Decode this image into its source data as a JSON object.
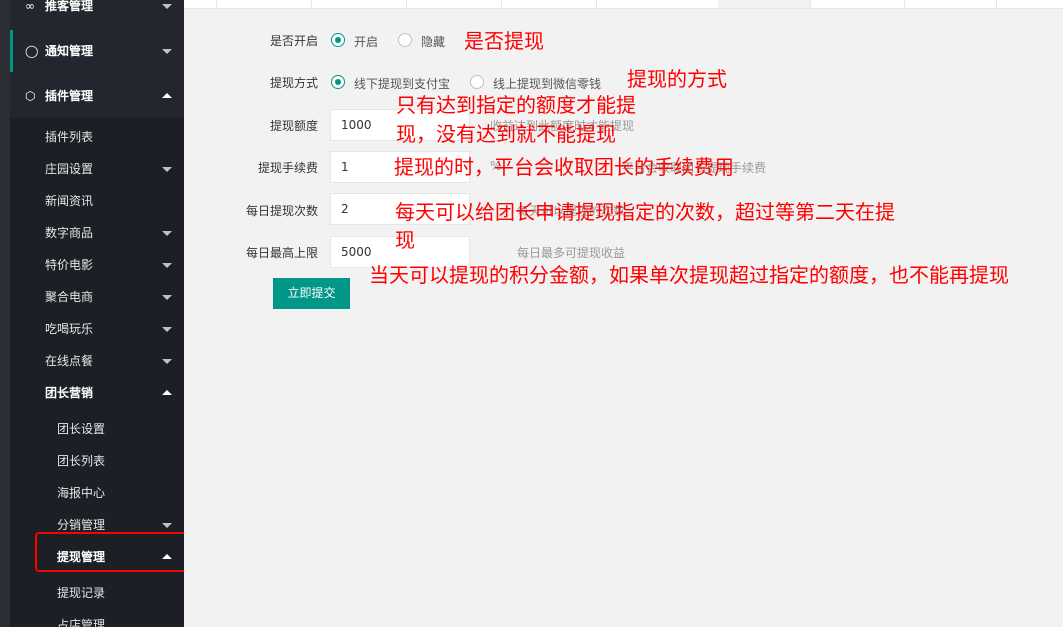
{
  "sidebar": {
    "top_items": [
      {
        "label": "推客管理",
        "icon": "share-icon"
      },
      {
        "label": "通知管理",
        "icon": "bell-icon"
      },
      {
        "label": "插件管理",
        "icon": "plugin-icon"
      }
    ],
    "plugin_items": [
      {
        "label": "插件列表"
      },
      {
        "label": "庄园设置"
      },
      {
        "label": "新闻资讯"
      },
      {
        "label": "数字商品"
      },
      {
        "label": "特价电影"
      },
      {
        "label": "聚合电商"
      },
      {
        "label": "吃喝玩乐"
      },
      {
        "label": "在线点餐"
      },
      {
        "label": "团长营销"
      }
    ],
    "leader_items": [
      {
        "label": "团长设置"
      },
      {
        "label": "团长列表"
      },
      {
        "label": "海报中心"
      },
      {
        "label": "分销管理"
      },
      {
        "label": "提现管理"
      },
      {
        "label": "提现记录"
      },
      {
        "label": "占店管理"
      }
    ],
    "colors": {
      "bg": "#23262e",
      "accent": "#009688",
      "highlight_border": "#ff0000"
    }
  },
  "form": {
    "enabled": {
      "label": "是否开启",
      "options": [
        "开启",
        "隐藏"
      ],
      "selected": "开启"
    },
    "method": {
      "label": "提现方式",
      "options": [
        "线下提现到支付宝",
        "线上提现到微信零钱"
      ],
      "selected": "线下提现到支付宝"
    },
    "amount": {
      "label": "提现额度",
      "value": "1000",
      "hint": "收益达到此额度时才能提现"
    },
    "fee": {
      "label": "提现手续费",
      "value": "1",
      "unit": "%",
      "hint": "平台会收取团长提现手续费"
    },
    "daily_count": {
      "label": "每日提现次数",
      "value": "2",
      "hint": "每天可以提现的次数"
    },
    "daily_max": {
      "label": "每日最高上限",
      "value": "5000",
      "hint": "每日最多可提现收益"
    },
    "submit_label": "立即提交",
    "colors": {
      "primary": "#009688"
    }
  },
  "annotations": {
    "enabled_note": "是否提现",
    "method_note": "提现的方式",
    "amount_note_1": "只有达到指定的额度才能提",
    "amount_note_2": "现，没有达到就不能提现",
    "fee_note": "提现的时，平台会收取团长的手续费用",
    "count_note_1": "每天可以给团长申请提现指定的次数，超过等第二天在提",
    "count_note_2": "现",
    "max_note": "当天可以提现的积分金额，如果单次提现超过指定的额度，也不能再提现",
    "color": "#ff0000"
  }
}
